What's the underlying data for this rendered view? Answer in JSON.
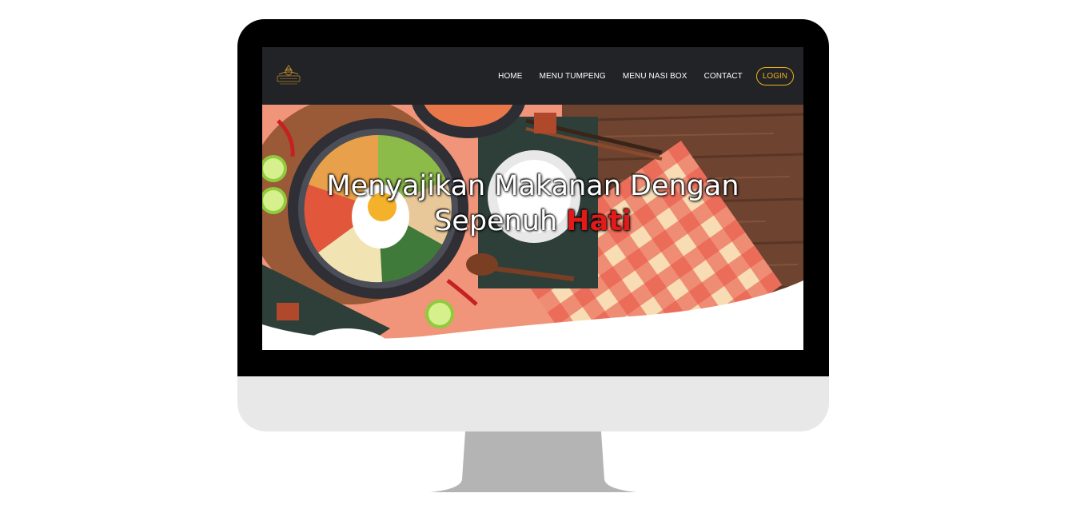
{
  "nav": {
    "logo_alt": "logo",
    "items": [
      {
        "label": "HOME"
      },
      {
        "label": "MENU TUMPENG"
      },
      {
        "label": "MENU NASI BOX"
      },
      {
        "label": "CONTACT"
      }
    ],
    "login_label": "LOGIN"
  },
  "hero": {
    "line1": "Menyajikan Makanan Dengan",
    "line2_prefix": "Sepenuh",
    "line2_accent": "Hati"
  },
  "colors": {
    "navbar_bg": "#212327",
    "login_accent": "#f2b01e",
    "headline_accent": "#e21a1a",
    "bezel": "#000000",
    "chin": "#e8e8e8",
    "stand": "#b4b4b4"
  }
}
